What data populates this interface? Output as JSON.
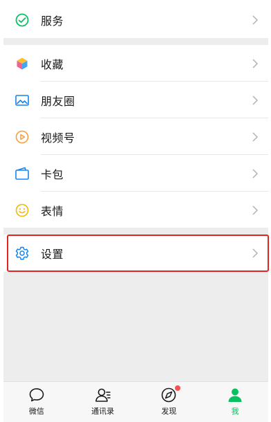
{
  "menu": {
    "services": {
      "label": "服务",
      "icon": "services-icon"
    },
    "items": [
      {
        "label": "收藏",
        "icon": "favorites-cube-icon"
      },
      {
        "label": "朋友圈",
        "icon": "moments-image-icon"
      },
      {
        "label": "视频号",
        "icon": "channels-play-icon"
      },
      {
        "label": "卡包",
        "icon": "card-wallet-icon"
      },
      {
        "label": "表情",
        "icon": "sticker-smiley-icon"
      }
    ],
    "settings": {
      "label": "设置",
      "icon": "settings-gear-icon"
    }
  },
  "tabbar": {
    "tabs": [
      {
        "label": "微信",
        "icon": "chat-bubble-icon",
        "active": false
      },
      {
        "label": "通讯录",
        "icon": "contacts-icon",
        "active": false
      },
      {
        "label": "发现",
        "icon": "discover-compass-icon",
        "active": false,
        "badge": true
      },
      {
        "label": "我",
        "icon": "me-person-icon",
        "active": true
      }
    ]
  },
  "colors": {
    "accent": "#07c160",
    "highlight_border": "#e1251b",
    "badge": "#fa5151",
    "background": "#ededed"
  }
}
